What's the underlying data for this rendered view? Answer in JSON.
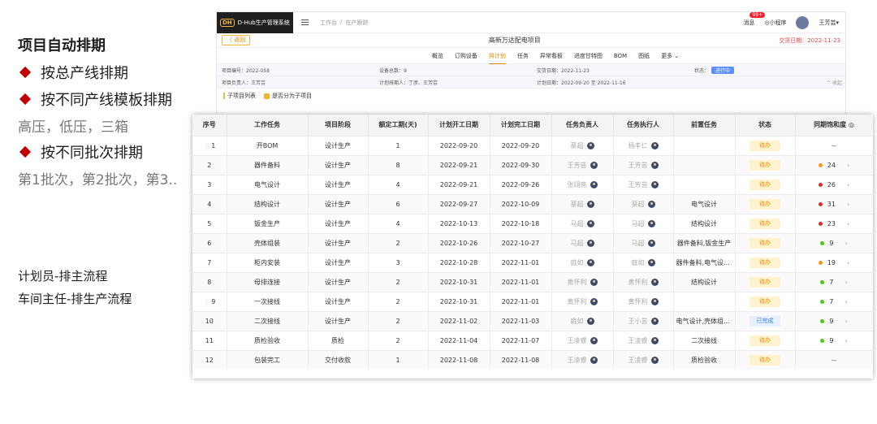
{
  "slide": {
    "title": "项目自动排期",
    "bullets": [
      "按总产线排期",
      "按不同产线模板排期",
      "按不同批次排期"
    ],
    "sub1": "高压，低压，三箱",
    "sub2": "第1批次，第2批次，第3..",
    "note1": "计划员-排主流程",
    "note2": "车间主任-排生产流程"
  },
  "app": {
    "logo_mark": "DH",
    "logo_text": "D-Hub生产管理系统",
    "breadcrumb": [
      "工作台",
      "/",
      "在产跟踪"
    ],
    "msg_label": "消息",
    "msg_count": "99+",
    "mini_program": "◎小程序",
    "user": "王芳芸▾",
    "back_label": "〈 返回",
    "project_name": "高新万达配电项目",
    "deliver_date": "交货日期：2022-11-23",
    "tabs": [
      "概览",
      "订购设备",
      "排计划",
      "任务",
      "异常看板",
      "进度甘特图",
      "BOM",
      "图纸",
      "更多 ⌄"
    ],
    "active_tab": 2,
    "info": {
      "code": "项目编号：2022-058",
      "device_total": "设备总数：9",
      "delivery": "交货日期：2022-11-23",
      "status_label": "状态：",
      "status_value": "进行中",
      "owner": "项目负责人：王芳芸",
      "planner": "计划排期人：丁彦、王芳芸",
      "plan_date": "计划日期：2022-09-20 至 2022-11-16",
      "collapse": "^ 收起"
    },
    "opt_sub_list": "子项目列表",
    "opt_percent": "是否分为子项目"
  },
  "table": {
    "headers": [
      "序号",
      "工作任务",
      "项目阶段",
      "额定工期(天)",
      "计划开工日期",
      "计划完工日期",
      "任务负责人",
      "任务执行人",
      "前置任务",
      "状态",
      "同期饱和度 ◎"
    ],
    "rows": [
      {
        "idx": "1",
        "task": "开BOM",
        "stage": "设计生产",
        "days": "1",
        "start": "2022-09-20",
        "end": "2022-09-20",
        "owner": "葵超",
        "exec": "杨丰仁",
        "pre": "",
        "state": "待办",
        "sat": "--",
        "dot": ""
      },
      {
        "idx": "2",
        "task": "器件备料",
        "stage": "设计生产",
        "days": "8",
        "start": "2022-09-21",
        "end": "2022-09-30",
        "owner": "王芳芸",
        "exec": "王芳芸",
        "pre": "",
        "state": "待办",
        "sat": "24",
        "dot": "#f29b1d"
      },
      {
        "idx": "3",
        "task": "电气设计",
        "stage": "设计生产",
        "days": "4",
        "start": "2022-09-21",
        "end": "2022-09-26",
        "owner": "张翊亮",
        "exec": "王芳芸",
        "pre": "",
        "state": "待办",
        "sat": "26",
        "dot": "#d93025"
      },
      {
        "idx": "4",
        "task": "结构设计",
        "stage": "设计生产",
        "days": "6",
        "start": "2022-09-27",
        "end": "2022-10-09",
        "owner": "葵超",
        "exec": "葵超",
        "pre": "电气设计",
        "state": "待办",
        "sat": "31",
        "dot": "#d93025"
      },
      {
        "idx": "5",
        "task": "钣金生产",
        "stage": "设计生产",
        "days": "4",
        "start": "2022-10-13",
        "end": "2022-10-18",
        "owner": "马超",
        "exec": "马超",
        "pre": "结构设计",
        "state": "待办",
        "sat": "23",
        "dot": "#d93025"
      },
      {
        "idx": "6",
        "task": "壳体组装",
        "stage": "设计生产",
        "days": "2",
        "start": "2022-10-26",
        "end": "2022-10-27",
        "owner": "马超",
        "exec": "马超",
        "pre": "器件备料,钣金生产",
        "state": "待办",
        "sat": "9",
        "dot": "#52c41a"
      },
      {
        "idx": "7",
        "task": "柜内安装",
        "stage": "设计生产",
        "days": "3",
        "start": "2022-10-28",
        "end": "2022-11-01",
        "owner": "庭如",
        "exec": "庭如",
        "pre": "器件备料,电气设计...",
        "state": "待办",
        "sat": "19",
        "dot": "#f29b1d"
      },
      {
        "idx": "8",
        "task": "母排连接",
        "stage": "设计生产",
        "days": "2",
        "start": "2022-10-31",
        "end": "2022-11-01",
        "owner": "黄怀利",
        "exec": "黄怀利",
        "pre": "结构设计",
        "state": "待办",
        "sat": "7",
        "dot": "#52c41a"
      },
      {
        "idx": "9",
        "task": "一次接线",
        "stage": "设计生产",
        "days": "2",
        "start": "2022-10-31",
        "end": "2022-11-01",
        "owner": "黄怀利",
        "exec": "黄怀利",
        "pre": "",
        "state": "待办",
        "sat": "7",
        "dot": "#52c41a"
      },
      {
        "idx": "10",
        "task": "二次接线",
        "stage": "设计生产",
        "days": "2",
        "start": "2022-11-02",
        "end": "2022-11-03",
        "owner": "庭如",
        "exec": "王小芸",
        "pre": "电气设计,壳体组装...",
        "state": "已完成",
        "sat": "9",
        "dot": "#52c41a"
      },
      {
        "idx": "11",
        "task": "质检验收",
        "stage": "质检",
        "days": "2",
        "start": "2022-11-04",
        "end": "2022-11-07",
        "owner": "王凌睿",
        "exec": "王凌睿",
        "pre": "二次接线",
        "state": "待办",
        "sat": "9",
        "dot": "#52c41a"
      },
      {
        "idx": "12",
        "task": "包装完工",
        "stage": "交付收款",
        "days": "1",
        "start": "2022-11-08",
        "end": "2022-11-08",
        "owner": "王凌睿",
        "exec": "王凌睿",
        "pre": "质检验收",
        "state": "待办",
        "sat": "--",
        "dot": ""
      }
    ]
  }
}
